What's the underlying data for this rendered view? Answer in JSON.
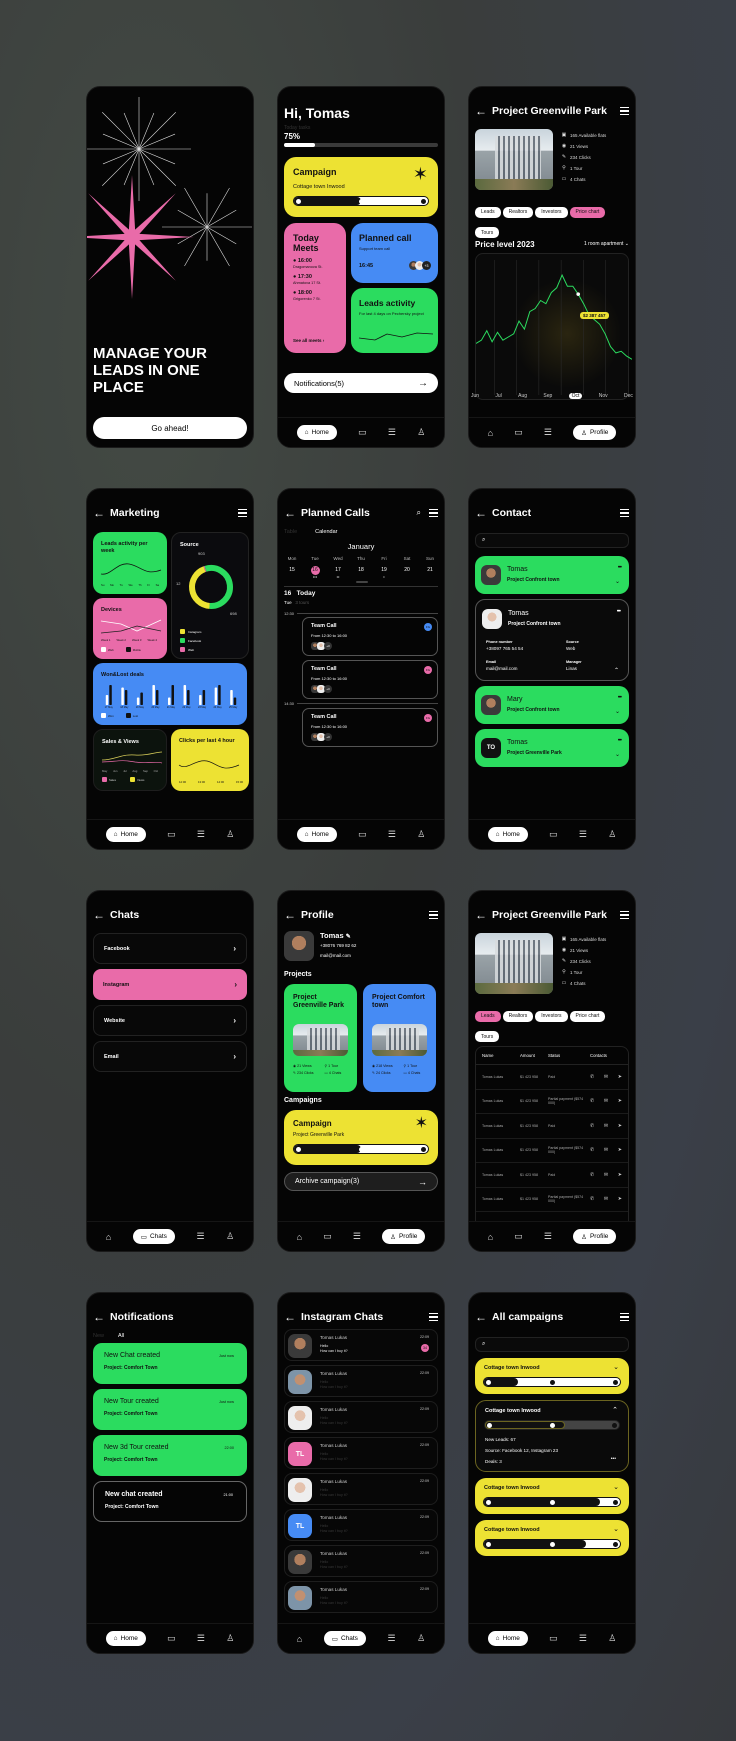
{
  "nav": {
    "home": "Home",
    "chats": "Chats",
    "profile": "Profile"
  },
  "onboarding": {
    "headline": "MANAGE YOUR LEADS IN ONE PLACE",
    "cta": "Go ahead!",
    "colors": {
      "star_pink": "#e96ba9"
    }
  },
  "home": {
    "greeting": "Hi, Tomas",
    "tasks_label": "Today tasks",
    "tasks_percent_text": "75%",
    "tasks_progress": 0.2,
    "campaign": {
      "title": "Campaign",
      "subtitle": "Cottage town Inwood",
      "progress": 0.5
    },
    "meets": {
      "title": "Today Meets",
      "items": [
        {
          "time": "16:00",
          "place": "Dragomanova St."
        },
        {
          "time": "17:30",
          "place": "Ahmatova 17 St."
        },
        {
          "time": "18:00",
          "place": "Grigorenko 7 St."
        }
      ],
      "see_all": "See all meets"
    },
    "planned_call": {
      "title": "Planned call",
      "subtitle": "Support team call",
      "time": "16:45",
      "extra": "+3"
    },
    "leads_activity": {
      "title": "Leads activity",
      "subtitle": "For last 4 days on Pechersky project"
    },
    "notifications": "Notifications(5)"
  },
  "project": {
    "title": "Project Greenville Park",
    "stats": [
      "165 Available flats",
      "21 Views",
      "234 Clicks",
      "1 Tour",
      "4 Chats"
    ],
    "chips": [
      "Leads",
      "Realtors",
      "Investors",
      "Price chart",
      "Tours"
    ],
    "active_chip": "Price chart",
    "price_title": "Price level 2023",
    "filter": "1 room apartment",
    "tooltip": "$2 387 457",
    "chart_data": {
      "type": "line",
      "title": "Price level 2023",
      "x_labels": [
        "Jun",
        "Jul",
        "Aug",
        "Sep",
        "Oct",
        "Nov",
        "Dec"
      ],
      "selected": "Oct",
      "values": [
        30,
        32,
        38,
        31,
        37,
        32,
        34,
        36,
        44,
        39,
        50,
        52,
        57,
        55,
        62,
        65,
        73,
        66,
        66,
        61,
        55,
        48,
        45,
        42,
        36,
        28,
        24,
        25,
        22,
        20
      ]
    }
  },
  "marketing": {
    "title": "Marketing",
    "leads_week": {
      "title": "Leads activity per week",
      "days": [
        "Su",
        "Mo",
        "Tu",
        "We",
        "Th",
        "Fr",
        "Sa"
      ]
    },
    "source": {
      "title": "Source",
      "labels": [
        "903",
        "12",
        "698"
      ],
      "legend": [
        "Instagram",
        "Facebook",
        "Web"
      ],
      "chart_data": {
        "type": "pie",
        "labels": [
          "Facebook",
          "Instagram",
          "Web"
        ],
        "values": [
          903,
          698,
          12
        ]
      }
    },
    "devices": {
      "title": "Devices",
      "weeks": [
        "Week 1",
        "Week 2",
        "Week 3",
        "Week 4"
      ],
      "legend": [
        "Web",
        "Mobile"
      ],
      "chart_data": {
        "type": "line",
        "series": [
          {
            "name": "Web",
            "values": [
              7,
              6,
              3,
              8
            ]
          },
          {
            "name": "Mobile",
            "values": [
              2,
              3,
              5,
              3
            ]
          }
        ]
      }
    },
    "won_lost": {
      "title": "Won&Lost deals",
      "days": [
        "17 May",
        "18 May",
        "19 May",
        "20 May",
        "21 May",
        "22 May",
        "23 May",
        "24 May",
        "25 May"
      ],
      "legend": [
        "Won",
        "Lost"
      ],
      "chart_data": {
        "type": "bar",
        "categories": [
          "17 May",
          "18 May",
          "19 May",
          "20 May",
          "21 May",
          "22 May",
          "23 May",
          "24 May",
          "25 May"
        ],
        "series": [
          {
            "name": "Won",
            "values": [
              4,
              7,
              3,
              8,
              3,
              8,
              4,
              7,
              6
            ]
          },
          {
            "name": "Lost",
            "values": [
              8,
              6,
              5,
              6,
              8,
              6,
              6,
              8,
              3
            ]
          }
        ]
      }
    },
    "sales_views": {
      "title": "Sales & Views",
      "months": [
        "May",
        "Jun",
        "Jul",
        "Aug",
        "Sep",
        "Oct"
      ],
      "legend": [
        "Sales",
        "Views"
      ]
    },
    "clicks": {
      "title": "Clicks per last 4 hour",
      "hours": [
        "12:00",
        "13:00",
        "14:00",
        "15:00"
      ]
    }
  },
  "planned_calls": {
    "title": "Planned Calls",
    "tabs": [
      "Table",
      "Calendar"
    ],
    "month": "January",
    "weekdays": [
      "Mon",
      "Tue",
      "Wed",
      "Thu",
      "Fri",
      "Sat",
      "Sun"
    ],
    "dates": [
      "15",
      "16",
      "17",
      "18",
      "19",
      "20",
      "21"
    ],
    "today_num": "16",
    "today_label": "Today",
    "today_day": "Tue",
    "today_tours": "3 tours",
    "times": [
      "12:30",
      "14:30"
    ],
    "calls": [
      {
        "title": "Team Call",
        "time": "From 12:30 to 16:00",
        "extra": "+3",
        "badge": "FG",
        "badge_color": "#468bf4"
      },
      {
        "title": "Team Call",
        "time": "From 12:30 to 16:00",
        "extra": "+3",
        "badge": "FG",
        "badge_color": "#e96ba9"
      },
      {
        "title": "Team Call",
        "time": "From 12:30 to 16:00",
        "extra": "+3",
        "badge": "FG",
        "badge_color": "#e96ba9"
      }
    ]
  },
  "contact": {
    "title": "Contact",
    "search_placeholder": "",
    "items": [
      {
        "name": "Tomas",
        "project": "Project Confront town"
      },
      {
        "name": "Tomas",
        "project": "Project Confront town",
        "phone_label": "Phone number",
        "phone": "+38097 765 54 54",
        "source_label": "Source",
        "source": "Web",
        "email_label": "Email",
        "email": "mail@mail.com",
        "manager_label": "Manager",
        "manager": "Linas"
      },
      {
        "name": "Mary",
        "project": "Project Confront town"
      },
      {
        "name": "Tomas",
        "project": "Project Greenville Park",
        "initials": "TO"
      }
    ]
  },
  "chats": {
    "title": "Chats",
    "items": [
      "Facebook",
      "Instagram",
      "Website",
      "Email"
    ],
    "active": "Instagram"
  },
  "profile": {
    "title": "Profile",
    "name": "Tomas",
    "phone": "+38076 769 82 62",
    "email": "mail@mail.com",
    "projects_title": "Projects",
    "projects": [
      {
        "name": "Project Greenville Park",
        "views": "21 Views",
        "tour": "1 Tour",
        "clicks": "234 Clicks",
        "chats": "4 Chats"
      },
      {
        "name": "Project Comfort town",
        "views": "218 Views",
        "tour": "1 Tour",
        "clicks": "24 Clicks",
        "chats": "4 Chats"
      }
    ],
    "campaigns_title": "Campaigns",
    "campaign": {
      "title": "Campaign",
      "subtitle": "Project Greenville Park",
      "progress": 0.5
    },
    "archive": "Archive campaign(3)"
  },
  "project_leads": {
    "title": "Project Greenville Park",
    "stats": [
      "165 Available flats",
      "21 Views",
      "234 Clicks",
      "1 Tour",
      "4 Chats"
    ],
    "chips": [
      "Leads",
      "Realtors",
      "Investors",
      "Price chart",
      "Tours"
    ],
    "active_chip": "Leads",
    "columns": [
      "Name",
      "Amount",
      "Status",
      "Contacts"
    ],
    "rows": [
      {
        "name": "Tomas Lukas",
        "amount": "$1 423 958",
        "status": "Paid"
      },
      {
        "name": "Tomas Lukas",
        "amount": "$1 423 958",
        "status": "Partial payment ($574 000)"
      },
      {
        "name": "Tomas Lukas",
        "amount": "$1 423 958",
        "status": "Paid"
      },
      {
        "name": "Tomas Lukas",
        "amount": "$1 423 958",
        "status": "Partial payment ($574 000)"
      },
      {
        "name": "Tomas Lukas",
        "amount": "$1 423 958",
        "status": "Paid"
      },
      {
        "name": "Tomas Lukas",
        "amount": "$1 423 958",
        "status": "Partial payment ($574 000)"
      }
    ]
  },
  "notifications": {
    "title": "Notifications",
    "tabs": [
      "New",
      "All"
    ],
    "items": [
      {
        "title": "New Chat created",
        "project": "Project: Comfort Town",
        "time": "Just now",
        "style": "green"
      },
      {
        "title": "New Tour created",
        "project": "Project: Comfort Town",
        "time": "Just now",
        "style": "green"
      },
      {
        "title": "New 3d Tour created",
        "project": "Project: Comfort Town",
        "time": "22:00",
        "style": "green"
      },
      {
        "title": "New chat created",
        "project": "Project: Comfort Town",
        "time": "21:00",
        "style": "outline"
      }
    ]
  },
  "instagram_chats": {
    "title": "Instagram Chats",
    "items": [
      {
        "name": "Tomas Lukas",
        "msg1": "Hello",
        "msg2": "How can I buy it?",
        "time": "22:09",
        "unread": "34",
        "avatar": "photo"
      },
      {
        "name": "Tomas Lukas",
        "msg1": "Hello",
        "msg2": "How can I buy it?",
        "time": "22:09",
        "avatar": "photo"
      },
      {
        "name": "Tomas Lukas",
        "msg1": "Hello",
        "msg2": "How can I buy it?",
        "time": "22:09",
        "avatar": "photo-light"
      },
      {
        "name": "Tomas Lukas",
        "msg1": "Hello",
        "msg2": "How can I buy it?",
        "time": "22:09",
        "avatar": "TL",
        "color": "#e96ba9"
      },
      {
        "name": "Tomas Lukas",
        "msg1": "Hello",
        "msg2": "How can I buy it?",
        "time": "22:09",
        "avatar": "photo-light"
      },
      {
        "name": "Tomas Lukas",
        "msg1": "Hello",
        "msg2": "How can I buy it?",
        "time": "22:09",
        "avatar": "TL",
        "color": "#468bf4"
      },
      {
        "name": "Tomas Lukas",
        "msg1": "Hello",
        "msg2": "How can I buy it?",
        "time": "22:09",
        "avatar": "photo"
      },
      {
        "name": "Tomas Lukas",
        "msg1": "Hello",
        "msg2": "How can I buy it?",
        "time": "22:09",
        "avatar": "photo"
      }
    ]
  },
  "all_campaigns": {
    "title": "All campaigns",
    "search_placeholder": "",
    "items": [
      {
        "title": "Cottage town Inwood",
        "progress": 0.25,
        "expanded": false
      },
      {
        "title": "Cottage town Inwood",
        "progress": 0.6,
        "expanded": true,
        "new_leads": "New Leads: 67",
        "source": "Source: Facebook 12, Instagram 23",
        "deals": "Deals: 3"
      },
      {
        "title": "Cottage town Inwood",
        "progress": 0.85,
        "expanded": false
      },
      {
        "title": "Cottage town Inwood",
        "progress": 0.75,
        "expanded": false
      }
    ]
  }
}
